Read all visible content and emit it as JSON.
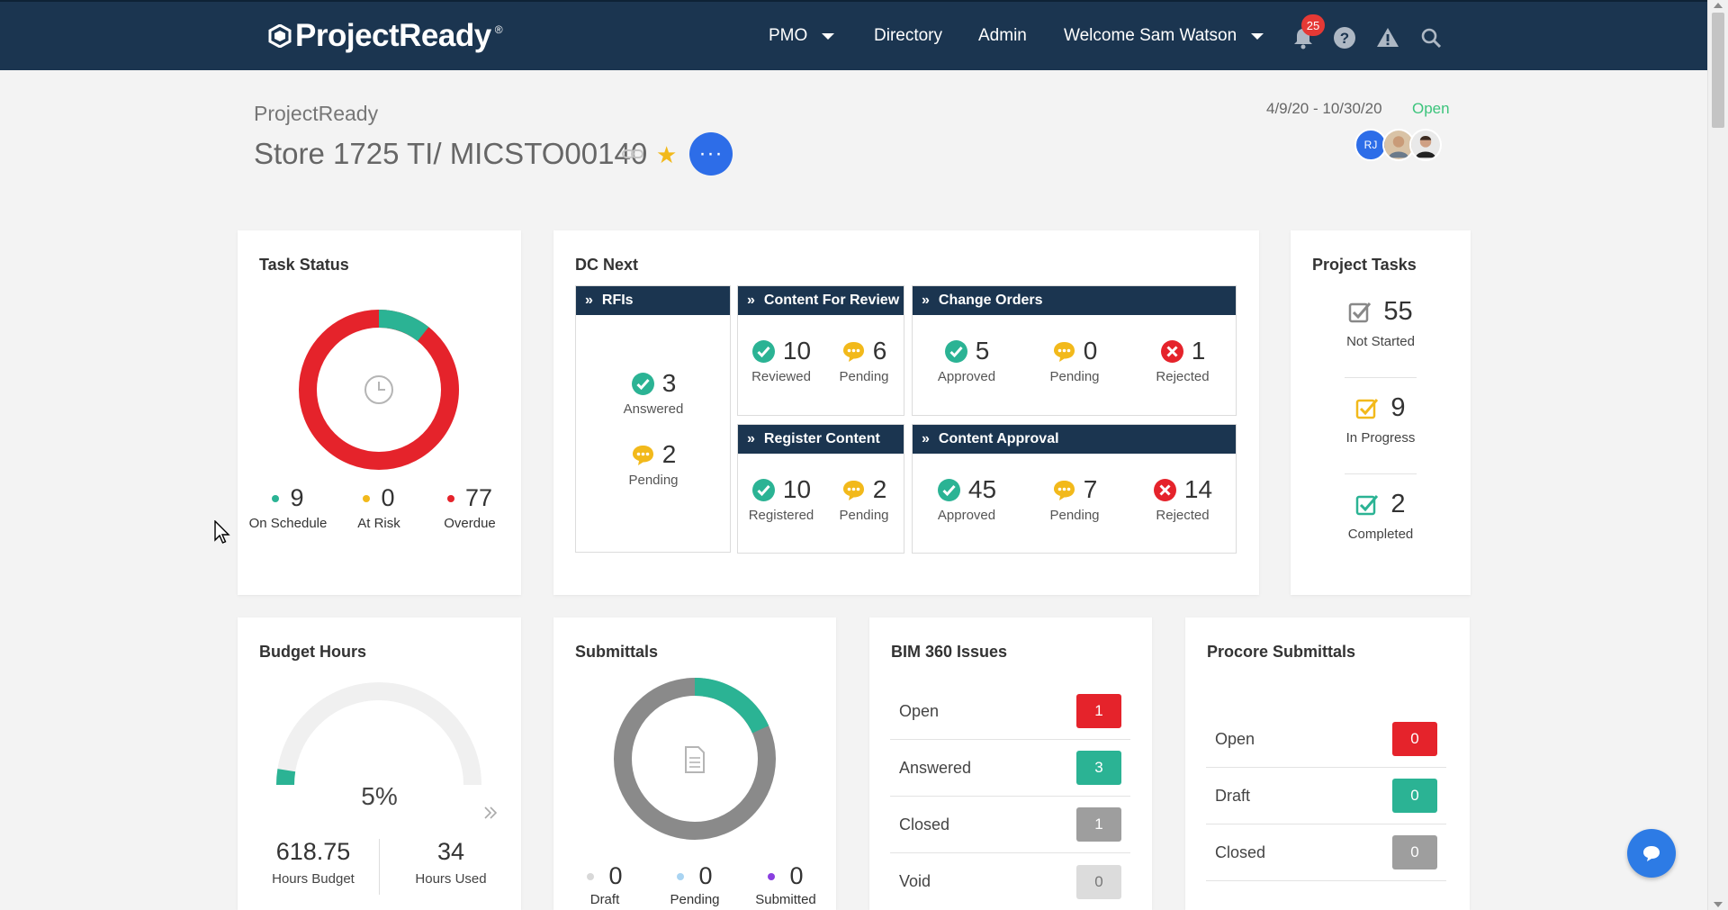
{
  "header": {
    "logo_text": "ProjectReady",
    "logo_reg": "®",
    "nav_pmo": "PMO",
    "nav_directory": "Directory",
    "nav_admin": "Admin",
    "nav_welcome": "Welcome Sam Watson",
    "notification_count": "25",
    "bg_color": "#1b3550"
  },
  "project": {
    "breadcrumb": "ProjectReady",
    "title": "Store 1725 TI/ MICSTO00140",
    "more_label": "···",
    "dates": "4/9/20 - 10/30/20",
    "status": "Open",
    "avatar_initials": "RJ"
  },
  "task_status": {
    "title": "Task Status",
    "on_schedule": {
      "value": "9",
      "label": "On Schedule",
      "color": "#2bb394"
    },
    "at_risk": {
      "value": "0",
      "label": "At Risk",
      "color": "#f2b91b"
    },
    "overdue": {
      "value": "77",
      "label": "Overdue",
      "color": "#e5232b"
    }
  },
  "dc_next": {
    "title": "DC Next",
    "rfis": {
      "title": "RFIs",
      "answered": "3",
      "answered_label": "Answered",
      "pending": "2",
      "pending_label": "Pending"
    },
    "content_review": {
      "title": "Content For Review",
      "reviewed": "10",
      "reviewed_label": "Reviewed",
      "pending": "6",
      "pending_label": "Pending"
    },
    "change_orders": {
      "title": "Change Orders",
      "approved": "5",
      "approved_label": "Approved",
      "pending": "0",
      "pending_label": "Pending",
      "rejected": "1",
      "rejected_label": "Rejected"
    },
    "register_content": {
      "title": "Register Content",
      "registered": "10",
      "registered_label": "Registered",
      "pending": "2",
      "pending_label": "Pending"
    },
    "content_approval": {
      "title": "Content Approval",
      "approved": "45",
      "approved_label": "Approved",
      "pending": "7",
      "pending_label": "Pending",
      "rejected": "14",
      "rejected_label": "Rejected"
    }
  },
  "project_tasks": {
    "title": "Project Tasks",
    "not_started": {
      "value": "55",
      "label": "Not Started"
    },
    "in_progress": {
      "value": "9",
      "label": "In Progress"
    },
    "completed": {
      "value": "2",
      "label": "Completed"
    }
  },
  "budget_hours": {
    "title": "Budget Hours",
    "percent_text": "5%",
    "percent_used": 0.05,
    "hours_budget": "618.75",
    "hours_budget_label": "Hours Budget",
    "hours_used": "34",
    "hours_used_label": "Hours Used"
  },
  "submittals": {
    "title": "Submittals",
    "draft": {
      "value": "0",
      "label": "Draft",
      "color": "#d8d8d8"
    },
    "pending": {
      "value": "0",
      "label": "Pending",
      "color": "#a9d4f2"
    },
    "submitted": {
      "value": "0",
      "label": "Submitted",
      "color": "#8a3fe0"
    }
  },
  "bim360": {
    "title": "BIM 360 Issues",
    "rows": [
      {
        "label": "Open",
        "value": "1",
        "color": "#e5232b"
      },
      {
        "label": "Answered",
        "value": "3",
        "color": "#2bb394"
      },
      {
        "label": "Closed",
        "value": "1",
        "color": "#9e9e9e"
      },
      {
        "label": "Void",
        "value": "0",
        "color": "#dcdcdc"
      }
    ]
  },
  "procore": {
    "title": "Procore Submittals",
    "rows": [
      {
        "label": "Open",
        "value": "0",
        "color": "#e5232b"
      },
      {
        "label": "Draft",
        "value": "0",
        "color": "#2bb394"
      },
      {
        "label": "Closed",
        "value": "0",
        "color": "#9e9e9e"
      }
    ]
  }
}
